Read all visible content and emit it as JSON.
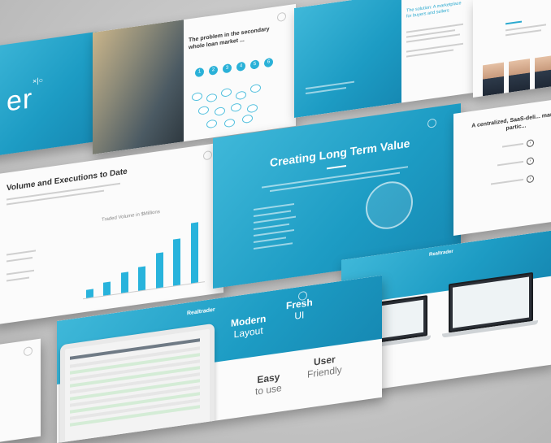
{
  "slides": {
    "logo": {
      "mark": "er"
    },
    "problems": {
      "title": "The problem in the secondary whole loan market ...",
      "steps": [
        "1",
        "2",
        "3",
        "4",
        "5",
        "6"
      ]
    },
    "marketplace": {
      "title": "The solution: A marketplace for buyers and sellers"
    },
    "volume": {
      "title": "Volume and Executions to Date",
      "chart_title": "Traded Volume in $Millions"
    },
    "value": {
      "title": "Creating Long Term Value"
    },
    "centralized": {
      "title": "A centralized, SaaS-deli... market partic..."
    },
    "laptops": {
      "title": "Realtrader"
    },
    "features": {
      "title": "Realtrader",
      "modern_a": "Modern",
      "modern_b": "Layout",
      "fresh_a": "Fresh",
      "fresh_b": "UI",
      "easy_a": "Easy",
      "easy_b": "to use",
      "user_a": "User",
      "user_b": "Friendly"
    }
  },
  "chart_data": {
    "type": "bar",
    "title": "Traded Volume in $Millions",
    "categories": [
      "",
      "",
      "",
      "",
      "",
      "",
      ""
    ],
    "values": [
      5,
      8,
      12,
      14,
      21,
      28,
      36
    ],
    "ylim": [
      0,
      40
    ]
  },
  "colors": {
    "accent": "#2aa9cf",
    "background": "#c6c6c6"
  }
}
